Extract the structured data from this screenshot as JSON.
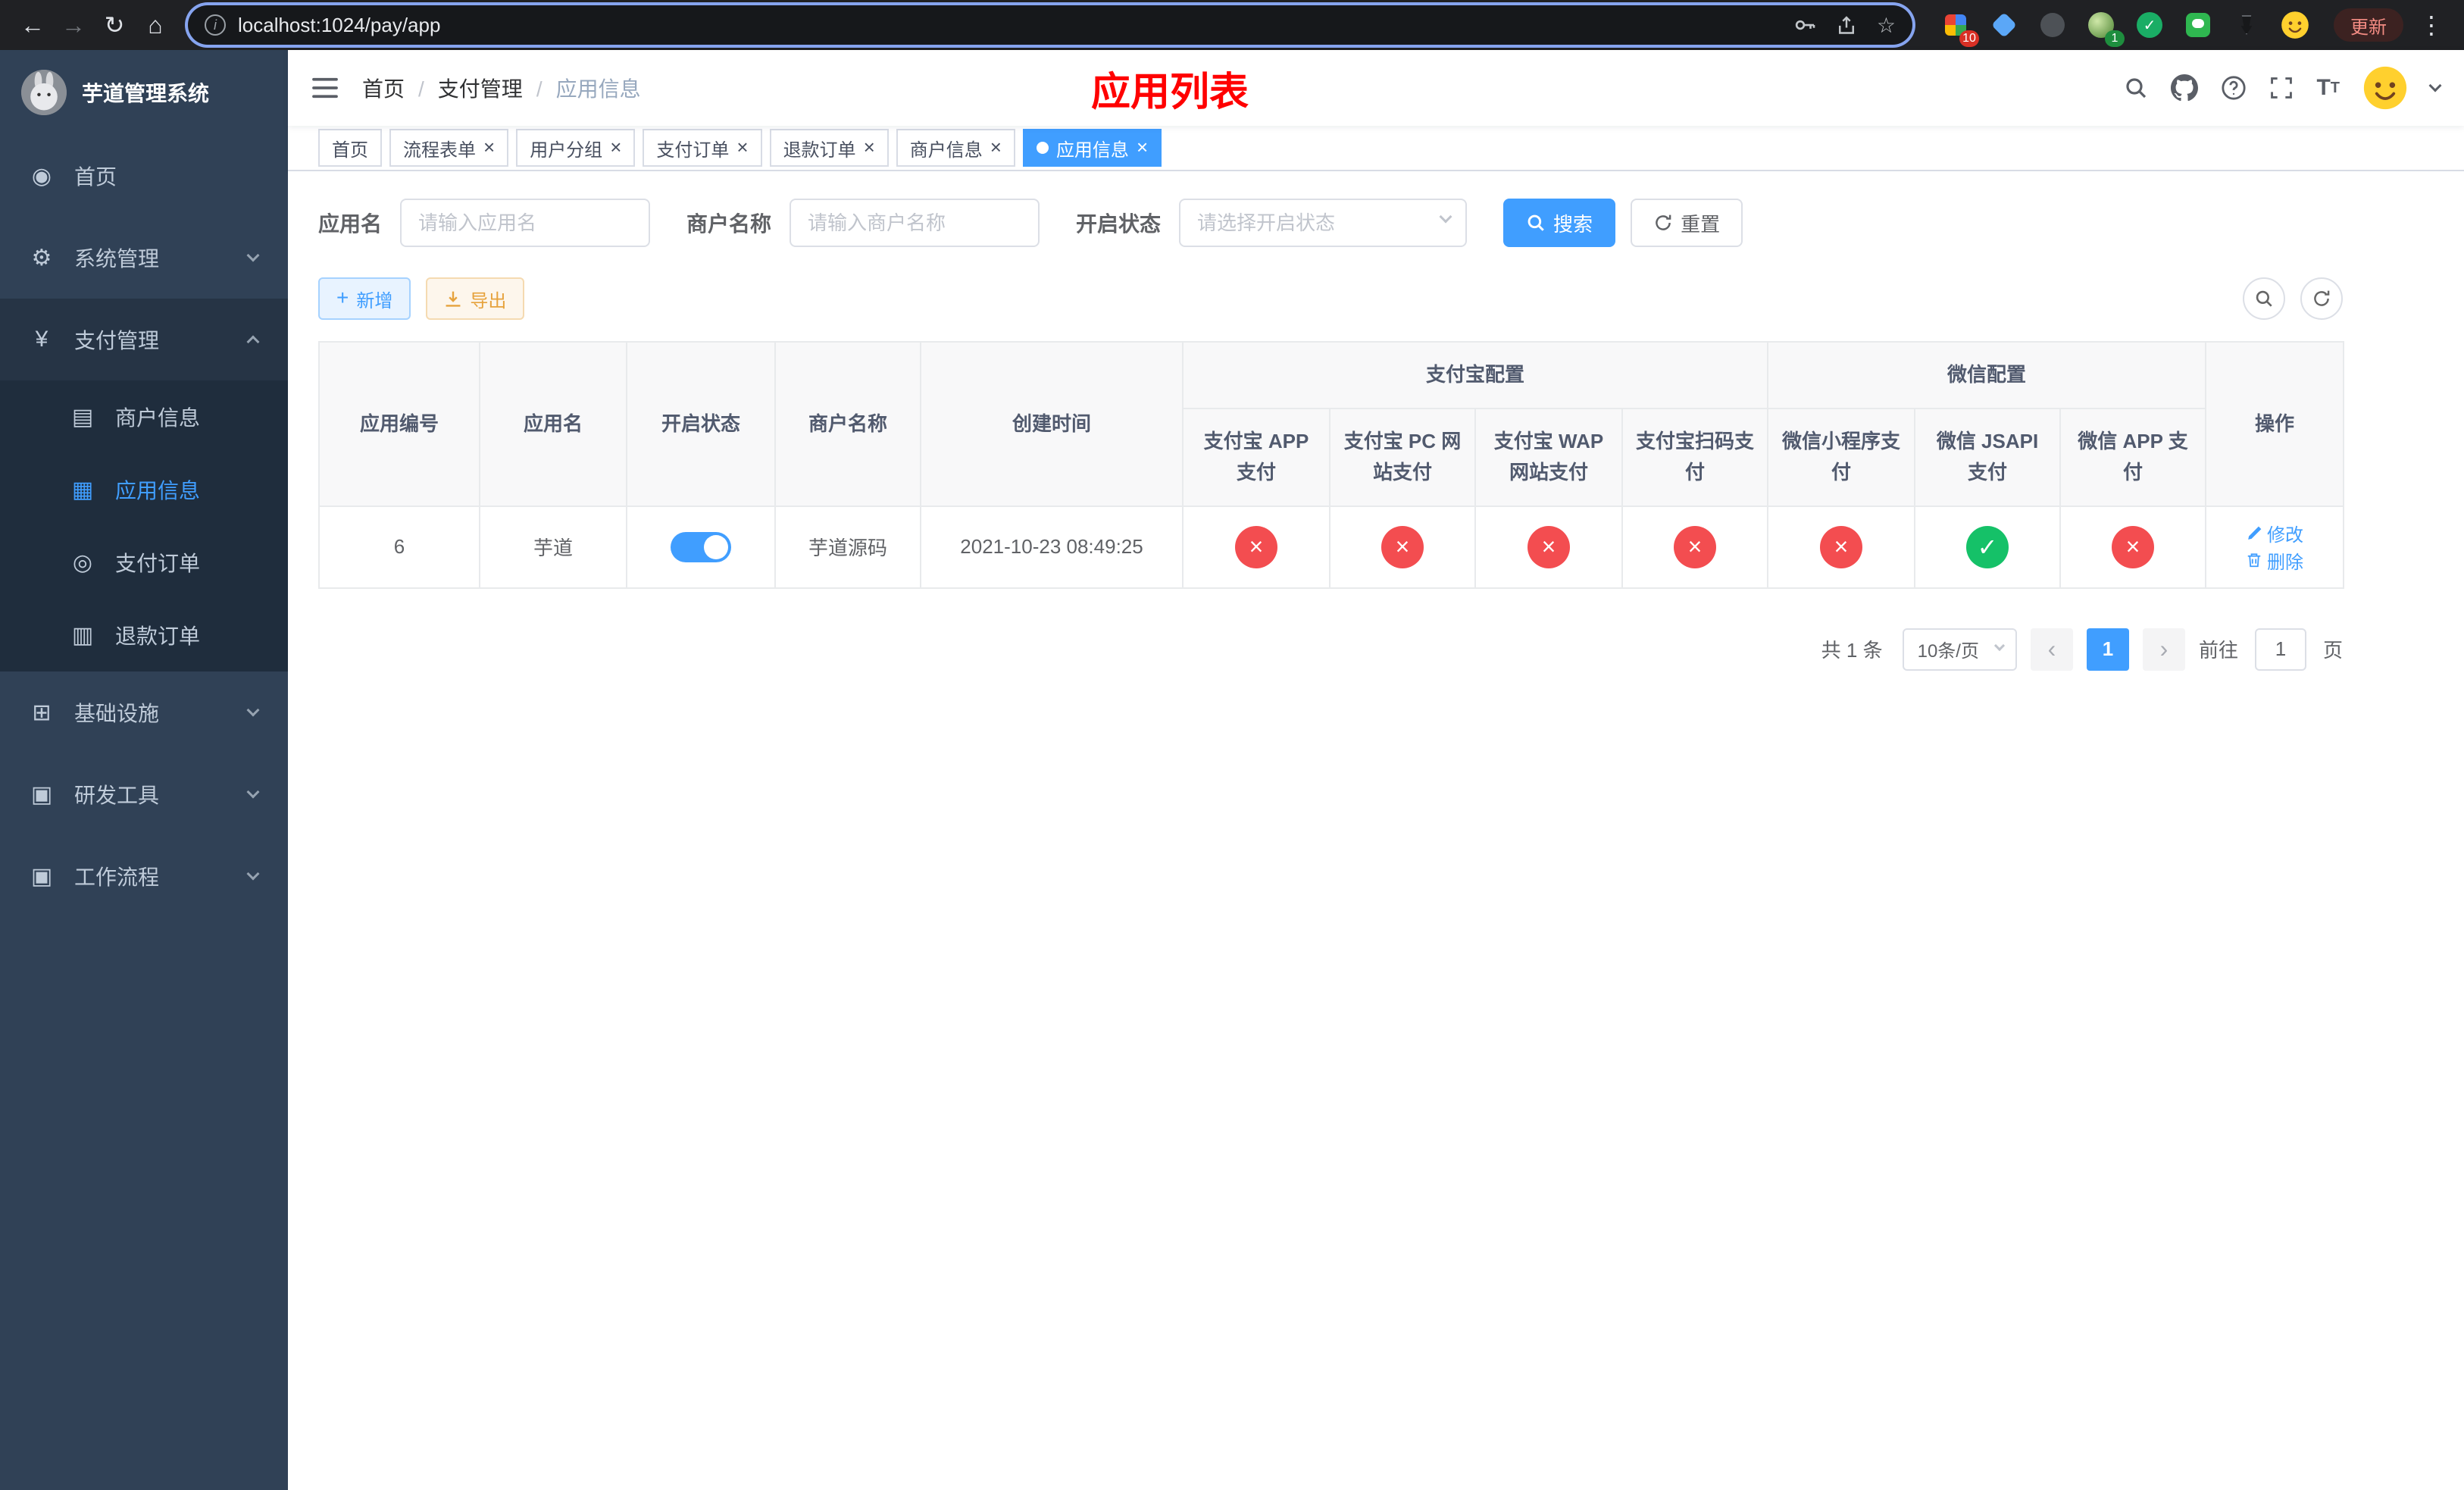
{
  "browser": {
    "url": "localhost:1024/pay/app",
    "update_label": "更新",
    "grid_badge": "10",
    "avatar_badge": "1"
  },
  "colors": {
    "accent": "#409eff",
    "danger": "#f34d50",
    "success": "#15c168",
    "title_red": "#ff0000",
    "sidebar_bg": "#304156"
  },
  "sidebar": {
    "title": "芋道管理系统",
    "items": [
      {
        "label": "首页"
      },
      {
        "label": "系统管理"
      },
      {
        "label": "支付管理",
        "children": [
          {
            "label": "商户信息"
          },
          {
            "label": "应用信息"
          },
          {
            "label": "支付订单"
          },
          {
            "label": "退款订单"
          }
        ]
      },
      {
        "label": "基础设施"
      },
      {
        "label": "研发工具"
      },
      {
        "label": "工作流程"
      }
    ]
  },
  "header": {
    "breadcrumb": [
      {
        "label": "首页"
      },
      {
        "label": "支付管理"
      },
      {
        "label": "应用信息"
      }
    ],
    "page_title": "应用列表"
  },
  "tabs": [
    {
      "label": "首页"
    },
    {
      "label": "流程表单"
    },
    {
      "label": "用户分组"
    },
    {
      "label": "支付订单"
    },
    {
      "label": "退款订单"
    },
    {
      "label": "商户信息"
    },
    {
      "label": "应用信息"
    }
  ],
  "filters": {
    "app_name_label": "应用名",
    "app_name_placeholder": "请输入应用名",
    "merchant_label": "商户名称",
    "merchant_placeholder": "请输入商户名称",
    "status_label": "开启状态",
    "status_placeholder": "请选择开启状态",
    "search_label": "搜索",
    "reset_label": "重置"
  },
  "toolbar": {
    "add_label": "新增",
    "export_label": "导出"
  },
  "table": {
    "headers": {
      "app_id": "应用编号",
      "app_name": "应用名",
      "status": "开启状态",
      "merchant": "商户名称",
      "created": "创建时间",
      "alipay_group": "支付宝配置",
      "wechat_group": "微信配置",
      "actions": "操作"
    },
    "sub_headers": [
      "支付宝 APP 支付",
      "支付宝 PC 网站支付",
      "支付宝 WAP 网站支付",
      "支付宝扫码支付",
      "微信小程序支付",
      "微信 JSAPI 支付",
      "微信 APP 支付"
    ],
    "row": {
      "id": "6",
      "name": "芋道",
      "enabled": true,
      "merchant": "芋道源码",
      "created": "2021-10-23 08:49:25",
      "configs": [
        "fail",
        "fail",
        "fail",
        "fail",
        "fail",
        "success",
        "fail"
      ],
      "edit_label": "修改",
      "delete_label": "删除"
    }
  },
  "pagination": {
    "total": "共 1 条",
    "page_size": "10条/页",
    "current": "1",
    "goto_prefix": "前往",
    "goto_value": "1",
    "goto_suffix": "页"
  }
}
